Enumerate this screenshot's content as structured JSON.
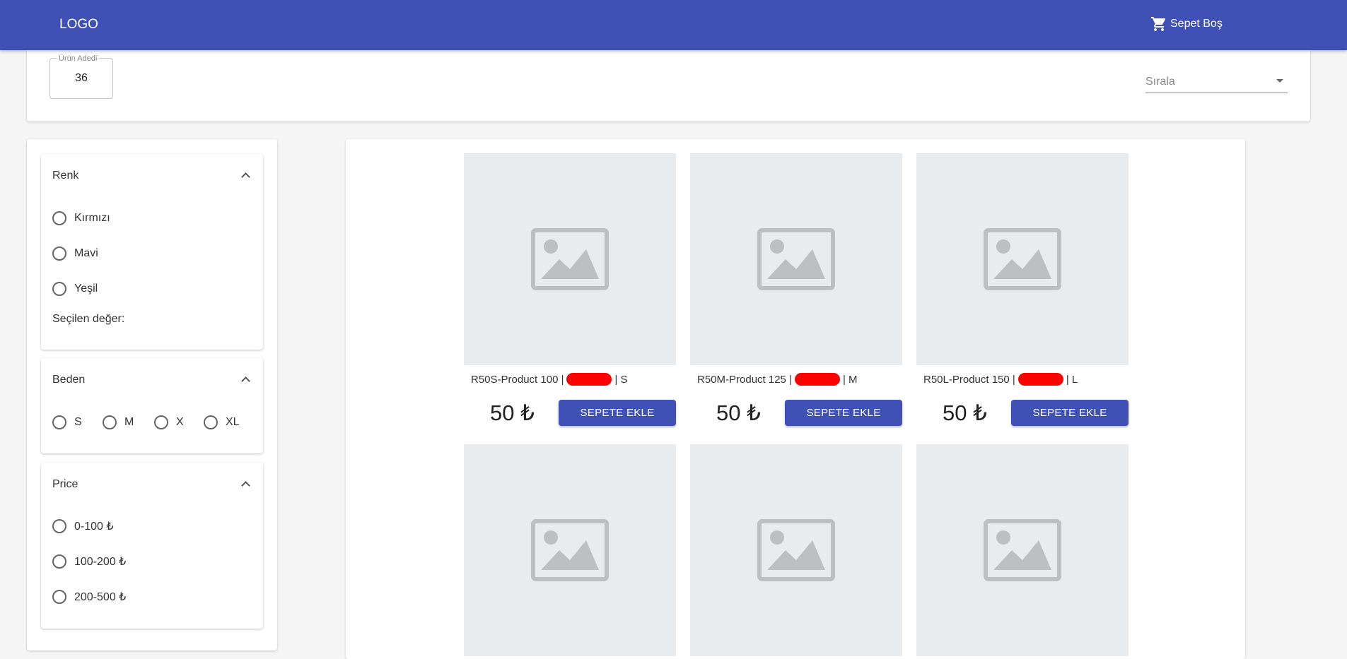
{
  "header": {
    "logo": "LOGO",
    "cart_label": "Sepet Boş"
  },
  "toolbar": {
    "quantity_label": "Ürün Adedi",
    "quantity_value": "36",
    "sort_label": "Sırala"
  },
  "filters": {
    "color": {
      "title": "Renk",
      "options": [
        "Kırmızı",
        "Mavi",
        "Yeşil"
      ],
      "selected_label": "Seçilen değer:"
    },
    "size": {
      "title": "Beden",
      "options": [
        "S",
        "M",
        "X",
        "XL"
      ]
    },
    "price": {
      "title": "Price",
      "options": [
        "0-100 ₺",
        "100-200 ₺",
        "200-500 ₺"
      ]
    }
  },
  "products": [
    {
      "name": "R50S-Product 100 |",
      "variant": "| S",
      "price": "50 ₺",
      "button": "SEPETE EKLE"
    },
    {
      "name": "R50M-Product 125 |",
      "variant": "| M",
      "price": "50 ₺",
      "button": "SEPETE EKLE"
    },
    {
      "name": "R50L-Product 150 |",
      "variant": "| L",
      "price": "50 ₺",
      "button": "SEPETE EKLE"
    },
    {
      "name": "",
      "variant": "",
      "price": "",
      "button": ""
    },
    {
      "name": "",
      "variant": "",
      "price": "",
      "button": ""
    },
    {
      "name": "",
      "variant": "",
      "price": "",
      "button": ""
    }
  ],
  "colors": {
    "primary": "#3f51b5",
    "placeholder_bg": "#e8ecee",
    "placeholder_icon": "#bdbfc1",
    "redaction": "#ff0000"
  }
}
